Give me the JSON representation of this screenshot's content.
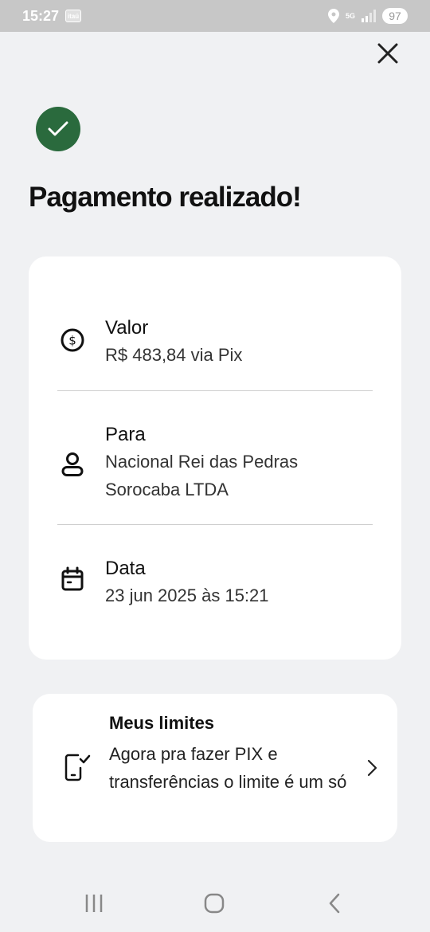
{
  "status_bar": {
    "time": "15:27",
    "app_badge": "itaú",
    "network": "5G",
    "battery": "97"
  },
  "page": {
    "title": "Pagamento realizado!"
  },
  "details": {
    "valor": {
      "label": "Valor",
      "value": "R$ 483,84 via Pix"
    },
    "para": {
      "label": "Para",
      "value_line1": "Nacional Rei das Pedras",
      "value_line2": "Sorocaba LTDA"
    },
    "data": {
      "label": "Data",
      "value": "23 jun 2025 às 15:21"
    }
  },
  "limits": {
    "title": "Meus limites",
    "description": "Agora pra fazer PIX e transferências o limite é um só"
  },
  "icons": {
    "success": "check-circle-icon",
    "close": "close-icon",
    "valor": "dollar-coin-icon",
    "para": "person-icon",
    "data": "calendar-icon",
    "limits": "phone-check-icon",
    "chevron": "chevron-right-icon"
  },
  "colors": {
    "success_green": "#2a6a3d",
    "background": "#f0f1f3",
    "card": "#ffffff"
  }
}
